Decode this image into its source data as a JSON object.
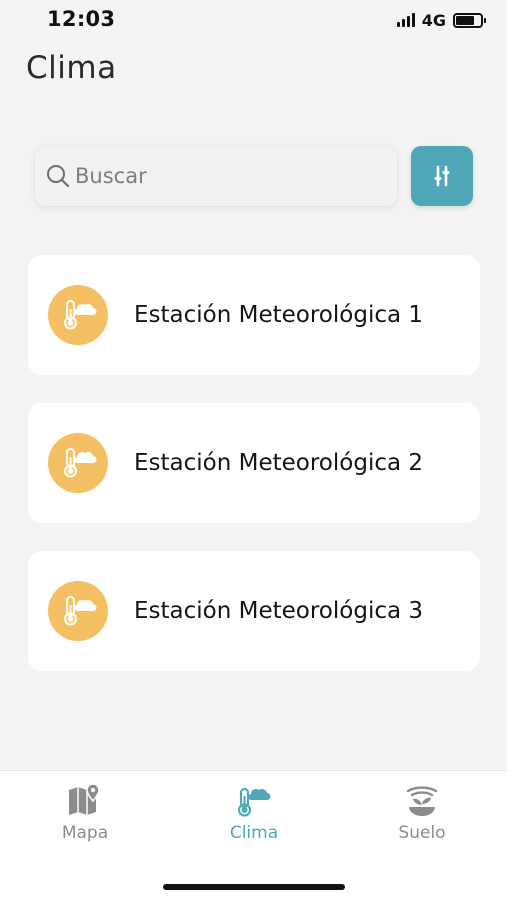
{
  "status_bar": {
    "time": "12:03",
    "network": "4G",
    "icons": [
      "cellular-signal-icon",
      "battery-icon"
    ]
  },
  "header": {
    "title": "Clima"
  },
  "search": {
    "placeholder": "Buscar",
    "value": "",
    "icon": "search-icon"
  },
  "filter_button": {
    "icon": "sliders-icon"
  },
  "stations": [
    {
      "name": "Estación Meteorológica 1",
      "icon": "thermometer-cloud-icon"
    },
    {
      "name": "Estación Meteorológica 2",
      "icon": "thermometer-cloud-icon"
    },
    {
      "name": "Estación Meteorológica 3",
      "icon": "thermometer-cloud-icon"
    }
  ],
  "nav": {
    "items": [
      {
        "label": "Mapa",
        "icon": "map-pin-icon",
        "active": false
      },
      {
        "label": "Clima",
        "icon": "thermometer-cloud-icon",
        "active": true
      },
      {
        "label": "Suelo",
        "icon": "soil-plant-icon",
        "active": false
      }
    ]
  },
  "colors": {
    "accent": "#4fa8b8",
    "station_icon_bg": "#f4c063",
    "nav_inactive": "#8c8c8c",
    "background": "#f4f4f5"
  }
}
